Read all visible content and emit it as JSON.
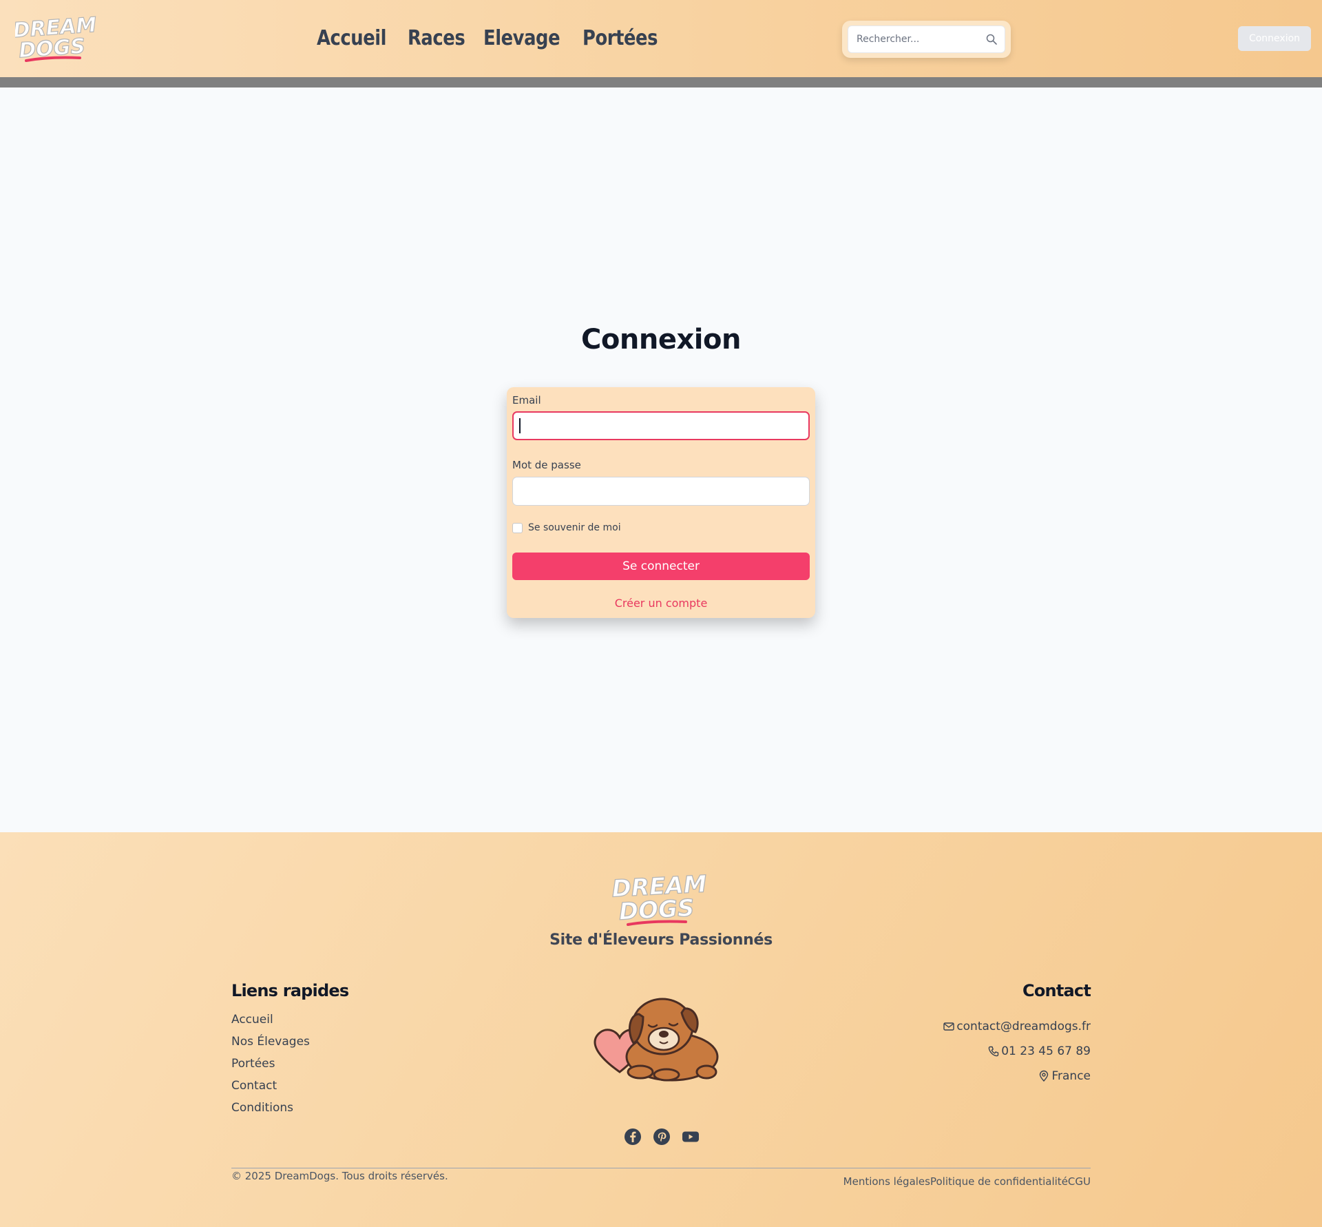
{
  "header": {
    "logo_text": [
      "DREAM",
      "DOGS"
    ],
    "nav": [
      "Accueil",
      "Races",
      "Elevage",
      "Portées"
    ],
    "search_placeholder": "Rechercher...",
    "login_button": "Connexion"
  },
  "main": {
    "title": "Connexion",
    "email_label": "Email",
    "email_value": "",
    "password_label": "Mot de passe",
    "password_value": "",
    "remember_label": "Se souvenir de moi",
    "remember_checked": false,
    "submit_label": "Se connecter",
    "create_account": "Créer un compte"
  },
  "footer": {
    "logo_text": [
      "DREAM",
      "DOGS"
    ],
    "tagline": "Site d'Éleveurs Passionnés",
    "quick_links_title": "Liens rapides",
    "quick_links": [
      "Accueil",
      "Nos Élevages",
      "Portées",
      "Contact",
      "Conditions"
    ],
    "contact_title": "Contact",
    "contact": {
      "email": "contact@dreamdogs.fr",
      "phone": "01 23 45 67 89",
      "location": "France"
    },
    "socials": [
      "facebook-icon",
      "pinterest-icon",
      "youtube-icon"
    ],
    "copyright": "© 2025 DreamDogs. Tous droits réservés.",
    "legal": [
      "Mentions légales",
      "Politique de confidentialité",
      "CGU"
    ]
  },
  "colors": {
    "accent": "#f43f6b",
    "header_bg": "#f8d2a0",
    "card_bg": "#fde0bd",
    "text_dark": "#374151"
  }
}
